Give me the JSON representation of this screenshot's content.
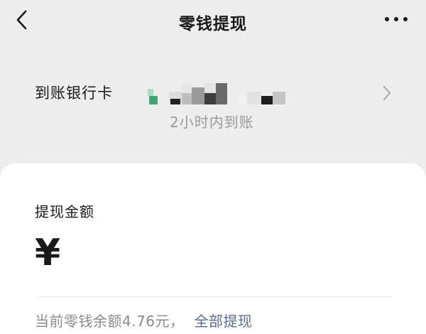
{
  "nav": {
    "title": "零钱提现",
    "back_icon": "chevron-left-icon",
    "more_icon": "more-dots-icon"
  },
  "bank": {
    "label": "到账银行卡",
    "arrival_time": "2小时内到账",
    "bank_logo_color": "#3aa96f"
  },
  "withdraw": {
    "label": "提现金额",
    "currency_symbol": "¥",
    "amount_value": "",
    "balance_text": "当前零钱余额4.76元，",
    "withdraw_all_label": "全部提现",
    "link_color": "#576b95"
  }
}
